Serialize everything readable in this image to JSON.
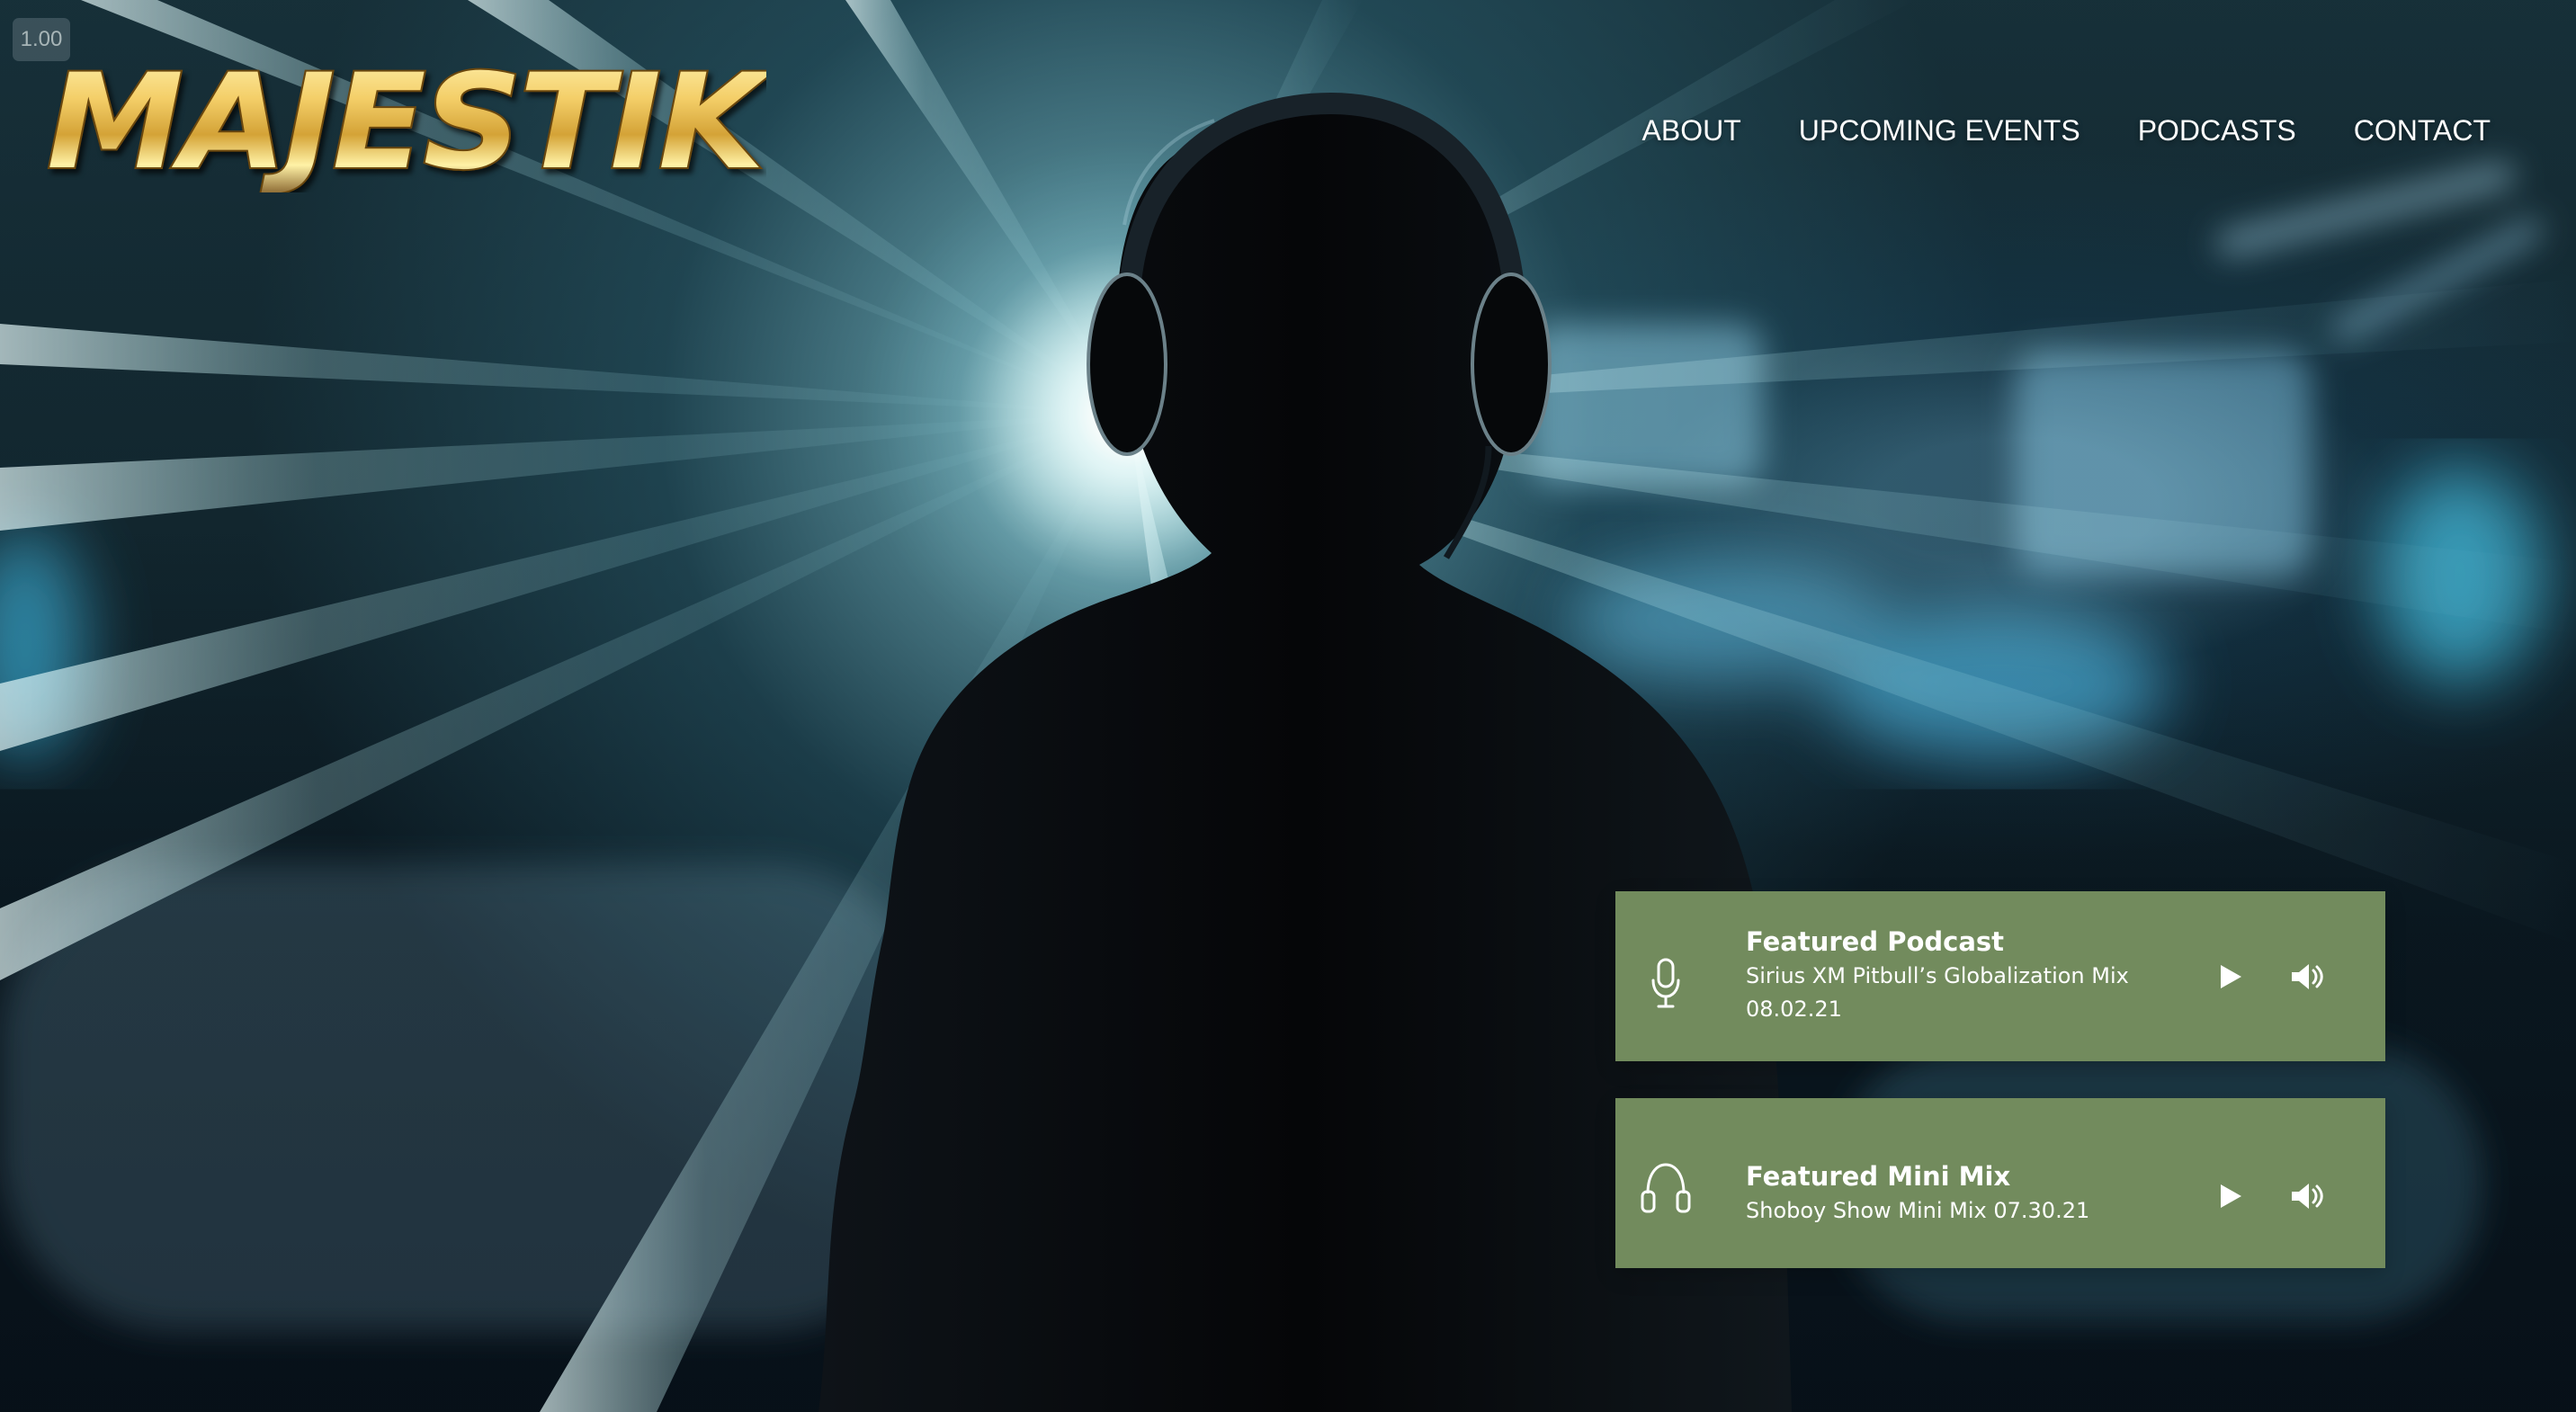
{
  "environment": {
    "version_badge": "1.00"
  },
  "brand": {
    "logo_text": "MAJESTIK",
    "logo_colors": {
      "gold_light": "#fff4b5",
      "gold_mid": "#d4a337",
      "gold_dark": "#76501d"
    }
  },
  "navigation": {
    "items": [
      {
        "label": "ABOUT"
      },
      {
        "label": "UPCOMING EVENTS"
      },
      {
        "label": "PODCASTS"
      },
      {
        "label": "CONTACT"
      }
    ]
  },
  "hero": {
    "background_scene": "nightclub-silhouette-with-headphones",
    "colors": {
      "deep": "#071018",
      "teal": "#2f7f91",
      "highlight": "#e8ffff"
    }
  },
  "featured": {
    "accent_color": "#728b5d",
    "podcast": {
      "icon": "microphone-icon",
      "title": "Featured Podcast",
      "subtitle": "Sirius XM Pitbull’s Globalization Mix 08.02.21",
      "play_icon": "play-icon",
      "volume_icon": "volume-icon"
    },
    "mini_mix": {
      "icon": "headphones-icon",
      "title": "Featured Mini Mix",
      "subtitle": "Shoboy Show Mini Mix 07.30.21",
      "play_icon": "play-icon",
      "volume_icon": "volume-icon"
    }
  }
}
